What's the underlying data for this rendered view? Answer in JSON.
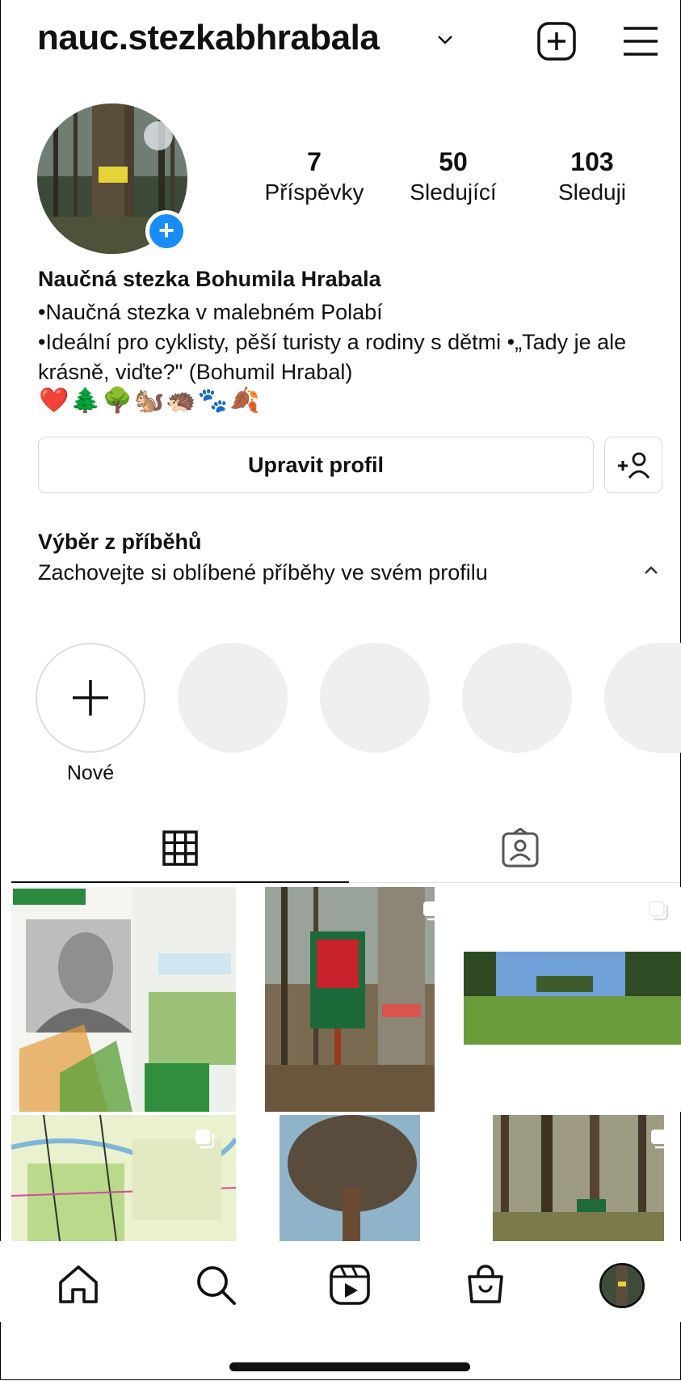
{
  "header": {
    "username": "nauc.stezkabhrabala",
    "icons": [
      "chevron-down-icon",
      "add-post-icon",
      "menu-icon"
    ]
  },
  "stats": [
    {
      "value": "7",
      "label": "Příspěvky"
    },
    {
      "value": "50",
      "label": "Sledující"
    },
    {
      "value": "103",
      "label": "Sleduji"
    }
  ],
  "profile": {
    "name": "Naučná stezka Bohumila Hrabala",
    "bio_line1": "•Naučná stezka v malebném Polabí",
    "bio_line2": "•Ideální pro cyklisty, pěší turisty a rodiny s dětmi •„Tady je ale krásně, viďte?\" (Bohumil Hrabal)",
    "emojis": "❤️🌲🌳🐿️🦔🐾🍂"
  },
  "buttons": {
    "edit_profile": "Upravit profil"
  },
  "highlights": {
    "title": "Výběr z příběhů",
    "subtitle": "Zachovejte si oblíbené příběhy ve svém profilu",
    "new_label": "Nové"
  },
  "tabs": [
    "grid-icon",
    "tagged-icon"
  ],
  "bottom_nav": [
    "home-icon",
    "search-icon",
    "reels-icon",
    "shop-icon",
    "profile-avatar"
  ],
  "colors": {
    "accent": "#1a8cf5",
    "placeholder": "#efefef"
  }
}
